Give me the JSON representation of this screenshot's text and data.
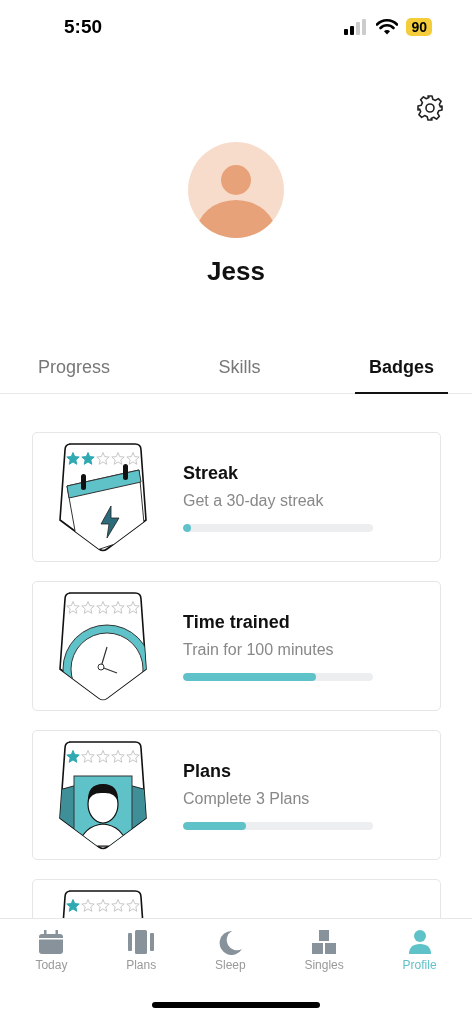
{
  "status_bar": {
    "time": "5:50",
    "battery": "90"
  },
  "profile": {
    "name": "Jess"
  },
  "tabs": [
    {
      "label": "Progress",
      "selected": false
    },
    {
      "label": "Skills",
      "selected": false
    },
    {
      "label": "Badges",
      "selected": true
    }
  ],
  "badges": [
    {
      "kind": "calendar",
      "stars": 2,
      "title": "Streak",
      "description": "Get a 30-day streak",
      "level": 0.03
    },
    {
      "kind": "clock",
      "stars": 0,
      "title": "Time trained",
      "description": "Train for 100 minutes",
      "level": 0.7
    },
    {
      "kind": "figure",
      "stars": 1,
      "title": "Plans",
      "description": "Complete 3 Plans",
      "level": 0.33
    },
    {
      "kind": "blank",
      "stars": 1
    }
  ],
  "nav": [
    {
      "kind": "today",
      "label": "Today",
      "selected": false
    },
    {
      "kind": "plans",
      "label": "Plans",
      "selected": false
    },
    {
      "kind": "sleep",
      "label": "Sleep",
      "selected": false
    },
    {
      "kind": "singles",
      "label": "Singles",
      "selected": false
    },
    {
      "kind": "profile",
      "label": "Profile",
      "selected": true
    }
  ]
}
